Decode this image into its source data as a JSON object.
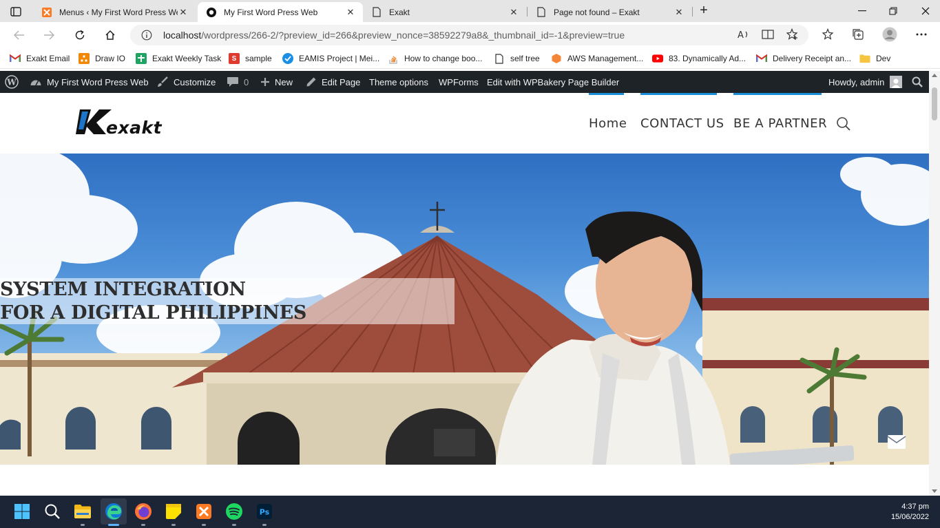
{
  "browser": {
    "tabs": [
      {
        "title": "Menus ‹ My First Word Press We",
        "icon": "xampp-icon",
        "active": false
      },
      {
        "title": "My First Word Press Web",
        "icon": "wp-theme-icon",
        "active": true
      },
      {
        "title": "Exakt",
        "icon": "page-icon",
        "active": false
      },
      {
        "title": "Page not found – Exakt",
        "icon": "page-icon",
        "active": false
      }
    ],
    "close_glyph": "✕",
    "new_tab_glyph": "+",
    "url": {
      "host": "localhost",
      "path": "/wordpress/266-2/?preview_id=266&preview_nonce=38592279a8&_thumbnail_id=-1&preview=true"
    },
    "bookmarks": [
      {
        "label": "Exakt Email",
        "icon": "gmail-icon"
      },
      {
        "label": "Draw IO",
        "icon": "drawio-icon"
      },
      {
        "label": "Exakt Weekly Task",
        "icon": "sheets-icon"
      },
      {
        "label": "sample",
        "icon": "s-icon"
      },
      {
        "label": "EAMIS Project | Mei...",
        "icon": "check-badge-icon"
      },
      {
        "label": "How to change boo...",
        "icon": "stackoverflow-icon"
      },
      {
        "label": "self tree",
        "icon": "page-icon"
      },
      {
        "label": "AWS Management...",
        "icon": "aws-icon"
      },
      {
        "label": "83. Dynamically Ad...",
        "icon": "youtube-icon"
      },
      {
        "label": "Delivery Receipt an...",
        "icon": "gmail-icon"
      },
      {
        "label": "Dev",
        "icon": "folder-icon"
      }
    ]
  },
  "adminbar": {
    "site_name": "My First Word Press Web",
    "customize": "Customize",
    "comments_count": "0",
    "new": "New",
    "edit_page": "Edit Page",
    "theme_options": "Theme options",
    "wpforms": "WPForms",
    "wpbakery": "Edit with WPBakery Page Builder",
    "howdy": "Howdy, admin"
  },
  "site": {
    "logo_text": "Kexakt",
    "menu": [
      "Home",
      "CONTACT US",
      "BE A PARTNER"
    ],
    "accent": "#1a8ed8",
    "hero": {
      "line1": "SYSTEM INTEGRATION",
      "line2": "FOR A DIGITAL PHILIPPINES"
    }
  },
  "taskbar": {
    "apps": [
      "start-icon",
      "search-icon",
      "file-explorer-icon",
      "edge-icon",
      "firefox-icon",
      "sticky-notes-icon",
      "xampp-icon",
      "spotify-icon",
      "photoshop-icon"
    ],
    "time": "4:37 pm",
    "date": "15/06/2022"
  }
}
